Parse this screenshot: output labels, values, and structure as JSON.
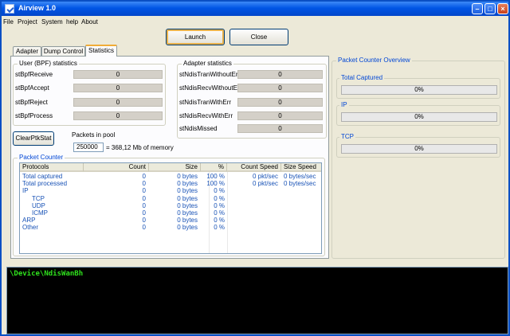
{
  "window": {
    "title": "Airview 1.0"
  },
  "menu": [
    "File",
    "Project",
    "System",
    "help",
    "About"
  ],
  "toolbar": {
    "launch_label": "Launch",
    "close_label": "Close"
  },
  "tabs": [
    {
      "label": "Adapter"
    },
    {
      "label": "Dump Control"
    },
    {
      "label": "Statistics"
    }
  ],
  "user_stats": {
    "title": "User (BPF) statistics",
    "rows": [
      {
        "label": "stBpfReceive",
        "value": "0"
      },
      {
        "label": "stBpfAccept",
        "value": "0"
      },
      {
        "label": "stBpfReject",
        "value": "0"
      },
      {
        "label": "stBpfProcess",
        "value": "0"
      }
    ]
  },
  "adapter_stats": {
    "title": "Adapter statistics",
    "rows": [
      {
        "label": "stNdisTranWithoutErr",
        "value": "0"
      },
      {
        "label": "stNdisRecvWithoutErr",
        "value": "0"
      },
      {
        "label": "stNdisTranWithErr",
        "value": "0"
      },
      {
        "label": "stNdisRecvWithErr",
        "value": "0"
      },
      {
        "label": "stNdisMissed",
        "value": "0"
      }
    ]
  },
  "clear_button": "ClearPtkStat",
  "pool": {
    "label": "Packets in pool",
    "value": "250000",
    "memory_text": "= 368,12 Mb of memory"
  },
  "packet_counter": {
    "title": "Packet Counter",
    "columns": [
      "Protocols",
      "Count",
      "Size",
      "%",
      "Count Speed",
      "Size Speed"
    ],
    "rows": [
      {
        "protocol": "Total captured",
        "count": "0",
        "size": "0 bytes",
        "pct": "100 %",
        "count_speed": "0 pkt/sec",
        "size_speed": "0 bytes/sec"
      },
      {
        "protocol": "Total processed",
        "count": "0",
        "size": "0 bytes",
        "pct": "100 %",
        "count_speed": "0 pkt/sec",
        "size_speed": "0 bytes/sec"
      },
      {
        "protocol": "IP",
        "count": "0",
        "size": "0 bytes",
        "pct": "0 %",
        "count_speed": "",
        "size_speed": ""
      },
      {
        "protocol": "TCP",
        "count": "0",
        "size": "0 bytes",
        "pct": "0 %",
        "count_speed": "",
        "size_speed": ""
      },
      {
        "protocol": "UDP",
        "count": "0",
        "size": "0 bytes",
        "pct": "0 %",
        "count_speed": "",
        "size_speed": ""
      },
      {
        "protocol": "ICMP",
        "count": "0",
        "size": "0 bytes",
        "pct": "0 %",
        "count_speed": "",
        "size_speed": ""
      },
      {
        "protocol": "ARP",
        "count": "0",
        "size": "0 bytes",
        "pct": "0 %",
        "count_speed": "",
        "size_speed": ""
      },
      {
        "protocol": "Other",
        "count": "0",
        "size": "0 bytes",
        "pct": "0 %",
        "count_speed": "",
        "size_speed": ""
      }
    ]
  },
  "overview": {
    "title": "Packet Counter Overview",
    "groups": [
      {
        "title": "Total Captured",
        "text": "0%",
        "fraction": 0
      },
      {
        "title": "IP",
        "text": "0%",
        "fraction": 0
      },
      {
        "title": "TCP",
        "text": "0%",
        "fraction": 0
      }
    ]
  },
  "console": {
    "text": "\\Device\\NdisWanBh"
  },
  "colors": {
    "console_bg": "#000000",
    "console_text": "#2fe21d",
    "title_bar": "#0055e5",
    "list_text": "#1852b6"
  }
}
